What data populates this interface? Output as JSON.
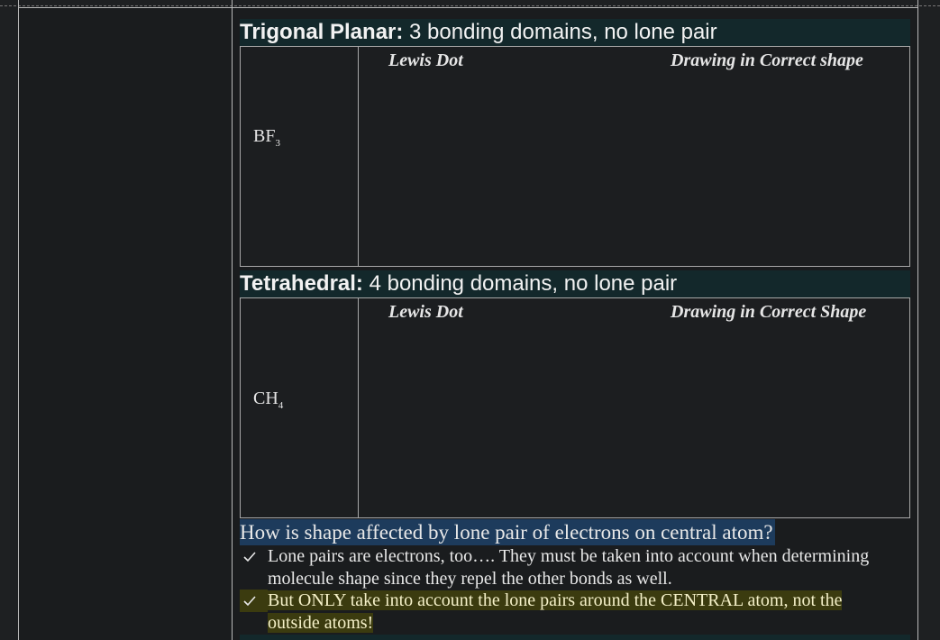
{
  "sections": [
    {
      "heading_bold": "Trigonal Planar:",
      "heading_rest": " 3 bonding domains, no lone pair",
      "molecule_main": "BF",
      "molecule_sub": "3",
      "col1": "Lewis Dot",
      "col2": "Drawing in Correct shape"
    },
    {
      "heading_bold": "Tetrahedral:",
      "heading_rest": " 4 bonding domains, no lone pair",
      "molecule_main": "CH",
      "molecule_sub": "4",
      "col1": "Lewis Dot",
      "col2": "Drawing in Correct Shape"
    }
  ],
  "question": "How is shape affected by lone pair of electrons on central atom?",
  "bullets": [
    {
      "icon": "checkmark-icon",
      "line1": "Lone pairs are electrons, too…. They must be taken into account when determining",
      "line2": "molecule shape since they repel the other bonds as well."
    },
    {
      "icon": "checkmark-icon",
      "line1": "But ONLY take into account the lone pairs around the CENTRAL atom, not the",
      "line2": "outside atoms!"
    }
  ],
  "colors": {
    "heading_bg": "#13282b",
    "question_bg": "#1d3b5c",
    "highlight_bg": "#3b3b0f"
  }
}
